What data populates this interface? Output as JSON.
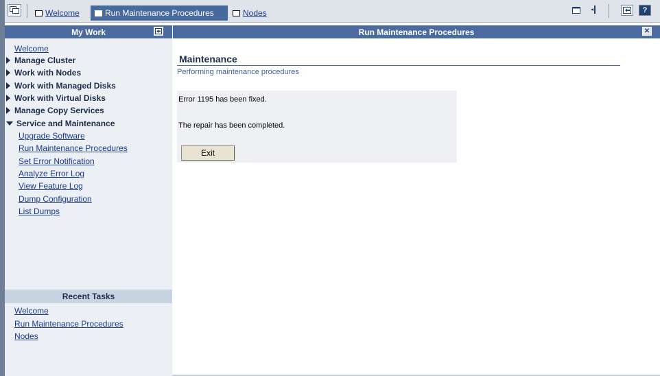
{
  "tabs": [
    {
      "label": "Welcome",
      "active": false
    },
    {
      "label": "Run Maintenance Procedures",
      "active": true
    },
    {
      "label": "Nodes",
      "active": false
    }
  ],
  "toolbar_icons": [
    "task-manager-icon",
    "minimize-icon",
    "refresh-icon",
    "maximize-icon",
    "help-icon"
  ],
  "sidebar": {
    "title": "My Work",
    "collapse_icon": "collapse-left-icon",
    "welcome": "Welcome",
    "groups": [
      {
        "label": "Manage Cluster",
        "expanded": false
      },
      {
        "label": "Work with Nodes",
        "expanded": false
      },
      {
        "label": "Work with Managed Disks",
        "expanded": false
      },
      {
        "label": "Work with Virtual Disks",
        "expanded": false
      },
      {
        "label": "Manage Copy Services",
        "expanded": false
      },
      {
        "label": "Service and Maintenance",
        "expanded": true
      }
    ],
    "sub_items": [
      "Upgrade Software",
      "Run Maintenance Procedures",
      "Set Error Notification",
      "Analyze Error Log",
      "View Feature Log",
      "Dump Configuration",
      "List Dumps"
    ],
    "recent": {
      "title": "Recent Tasks",
      "items": [
        "Welcome",
        "Run Maintenance Procedures",
        "Nodes"
      ]
    }
  },
  "main": {
    "header_title": "Run Maintenance Procedures",
    "close_icon": "close-icon",
    "title": "Maintenance",
    "subtitle": "Performing maintenance procedures",
    "message1": "Error 1195 has been fixed.",
    "message2": "The repair has been completed.",
    "exit_label": "Exit"
  },
  "colors": {
    "header_blue": "#4a6aa0",
    "sidebar_bg": "#eceff4",
    "link": "#1a3c8c"
  }
}
